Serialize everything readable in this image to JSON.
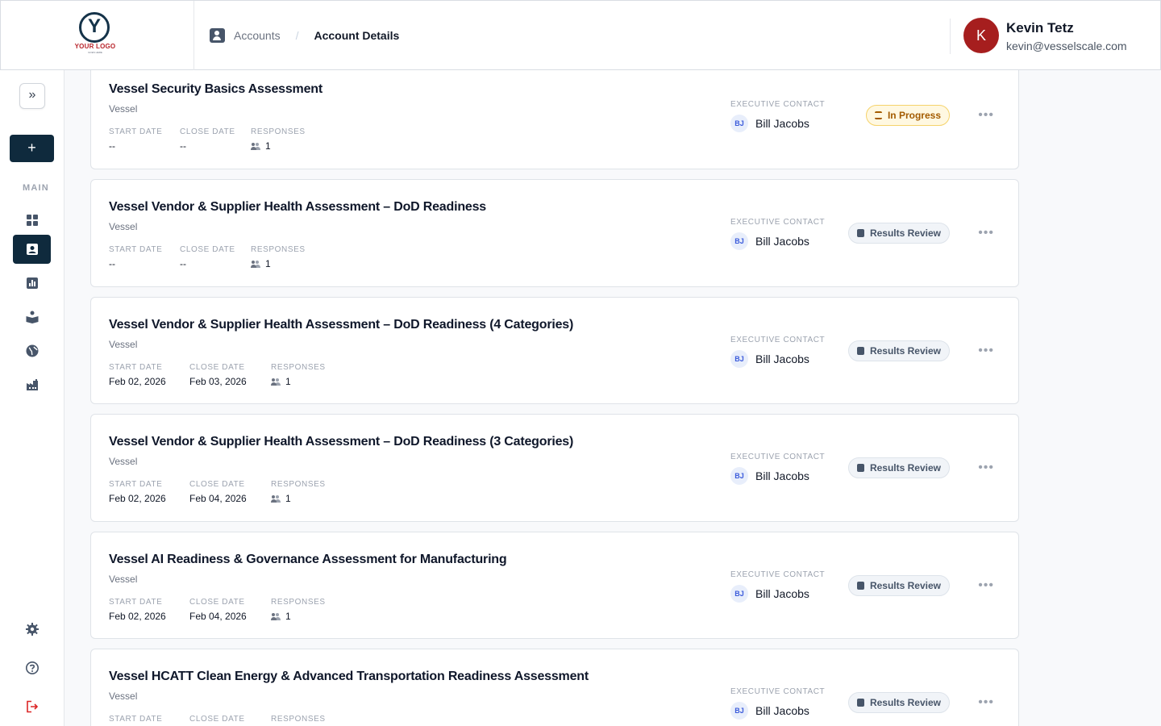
{
  "header": {
    "logo_text": "YOUR LOGO",
    "logo_sub": "GOES HERE",
    "breadcrumb": {
      "link": "Accounts",
      "separator": "/",
      "current": "Account Details"
    },
    "user": {
      "initial": "K",
      "name": "Kevin Tetz",
      "email": "kevin@vesselscale.com"
    }
  },
  "sidebar": {
    "expand_icon": "»",
    "add_icon": "+",
    "section_label": "MAIN",
    "items": [
      {
        "icon": "dashboard-icon",
        "active": false
      },
      {
        "icon": "accounts-icon",
        "active": true
      },
      {
        "icon": "reports-icon",
        "active": false
      },
      {
        "icon": "learning-icon",
        "active": false
      },
      {
        "icon": "globe-icon",
        "active": false
      },
      {
        "icon": "factory-icon",
        "active": false
      }
    ],
    "bottom": [
      "settings-icon",
      "help-icon",
      "logout-icon"
    ]
  },
  "labels": {
    "start_date": "START DATE",
    "close_date": "CLOSE DATE",
    "responses": "RESPONSES",
    "executive_contact": "EXECUTIVE CONTACT",
    "more": "•••"
  },
  "assessments": [
    {
      "title": "Vessel Security Basics Assessment",
      "org": "Vessel",
      "start": "--",
      "close": "--",
      "responses": "1",
      "contact_initials": "BJ",
      "contact": "Bill Jacobs",
      "status": "In Progress"
    },
    {
      "title": "Vessel Vendor & Supplier Health Assessment – DoD Readiness",
      "org": "Vessel",
      "start": "--",
      "close": "--",
      "responses": "1",
      "contact_initials": "BJ",
      "contact": "Bill Jacobs",
      "status": "Results Review"
    },
    {
      "title": "Vessel Vendor & Supplier Health Assessment – DoD Readiness (4 Categories)",
      "org": "Vessel",
      "start": "Feb 02, 2026",
      "close": "Feb 03, 2026",
      "responses": "1",
      "contact_initials": "BJ",
      "contact": "Bill Jacobs",
      "status": "Results Review"
    },
    {
      "title": "Vessel Vendor & Supplier Health Assessment – DoD Readiness (3 Categories)",
      "org": "Vessel",
      "start": "Feb 02, 2026",
      "close": "Feb 04, 2026",
      "responses": "1",
      "contact_initials": "BJ",
      "contact": "Bill Jacobs",
      "status": "Results Review"
    },
    {
      "title": "Vessel AI Readiness & Governance Assessment for Manufacturing",
      "org": "Vessel",
      "start": "Feb 02, 2026",
      "close": "Feb 04, 2026",
      "responses": "1",
      "contact_initials": "BJ",
      "contact": "Bill Jacobs",
      "status": "Results Review"
    },
    {
      "title": "Vessel HCATT Clean Energy & Advanced Transportation Readiness Assessment",
      "org": "Vessel",
      "start": "",
      "close": "",
      "responses": "",
      "contact_initials": "BJ",
      "contact": "Bill Jacobs",
      "status": "Results Review"
    }
  ],
  "colors": {
    "primary": "#0f2a3d",
    "avatar": "#a61e1e",
    "progress": "#a35b00"
  }
}
